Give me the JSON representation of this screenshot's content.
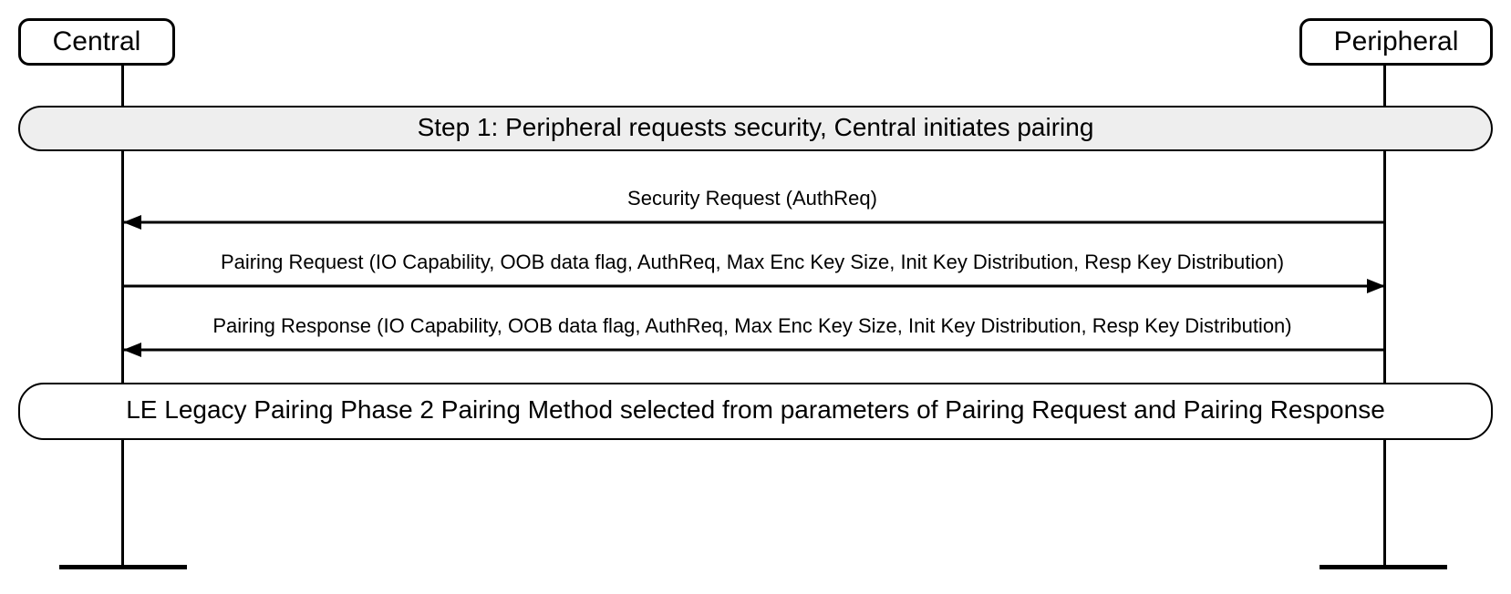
{
  "actors": {
    "central": "Central",
    "peripheral": "Peripheral"
  },
  "step1": "Step 1: Peripheral requests security, Central initiates pairing",
  "messages": {
    "m1": "Security Request (AuthReq)",
    "m2": "Pairing Request (IO Capability, OOB data flag, AuthReq, Max Enc Key Size, Init Key Distribution, Resp Key Distribution)",
    "m3": "Pairing Response (IO Capability, OOB data flag, AuthReq, Max Enc Key Size, Init Key Distribution, Resp Key Distribution)"
  },
  "note": "LE Legacy Pairing Phase 2 Pairing Method selected from parameters of Pairing Request and Pairing Response"
}
